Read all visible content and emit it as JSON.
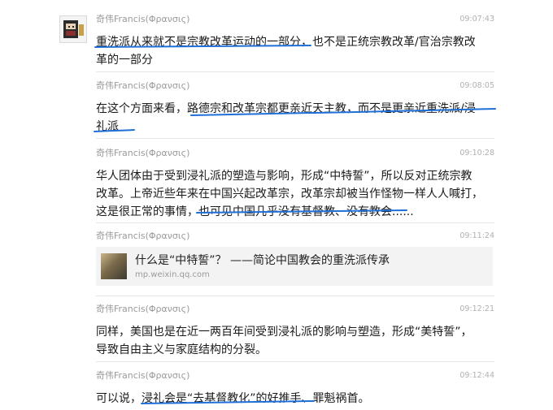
{
  "messages": [
    {
      "sender": "奇伟Francis(Φρανσις)",
      "time": "09:07:43",
      "text": "重洗派从来就不是宗教改革运动的一部分，也不是正统宗教改革/官治宗教改\n革的一部分"
    },
    {
      "sender": "奇伟Francis(Φρανσις)",
      "time": "09:08:05",
      "text": "在这个方面来看，路德宗和改革宗都更亲近天主教，而不是更亲近重洗派/浸\n礼派"
    },
    {
      "sender": "奇伟Francis(Φρανσις)",
      "time": "09:10:28",
      "text": "华人团体由于受到浸礼派的塑造与影响，形成“中特誓”，所以反对正统宗教\n改革。上帝近些年来在中国兴起改革宗，改革宗却被当作怪物一样人人喊打，\n这是很正常的事情，也可见中国几乎没有基督教、没有教会......"
    },
    {
      "sender": "奇伟Francis(Φρανσις)",
      "time": "09:11:24",
      "link_title": "什么是“中特誓”？ ——简论中国教会的重洗派传承",
      "link_url": "mp.weixin.qq.com"
    },
    {
      "sender": "奇伟Francis(Φρανσις)",
      "time": "09:12:21",
      "text": "同样，美国也是在近一两百年间受到浸礼派的影响与塑造，形成“美特誓”，\n导致自由主义与家庭结构的分裂。"
    },
    {
      "sender": "奇伟Francis(Φρανσις)",
      "time": "09:12:44",
      "text": "可以说，浸礼会是“去基督教化”的好推手、罪魁祸首。"
    }
  ],
  "annotation_color": "#1f6fd8"
}
